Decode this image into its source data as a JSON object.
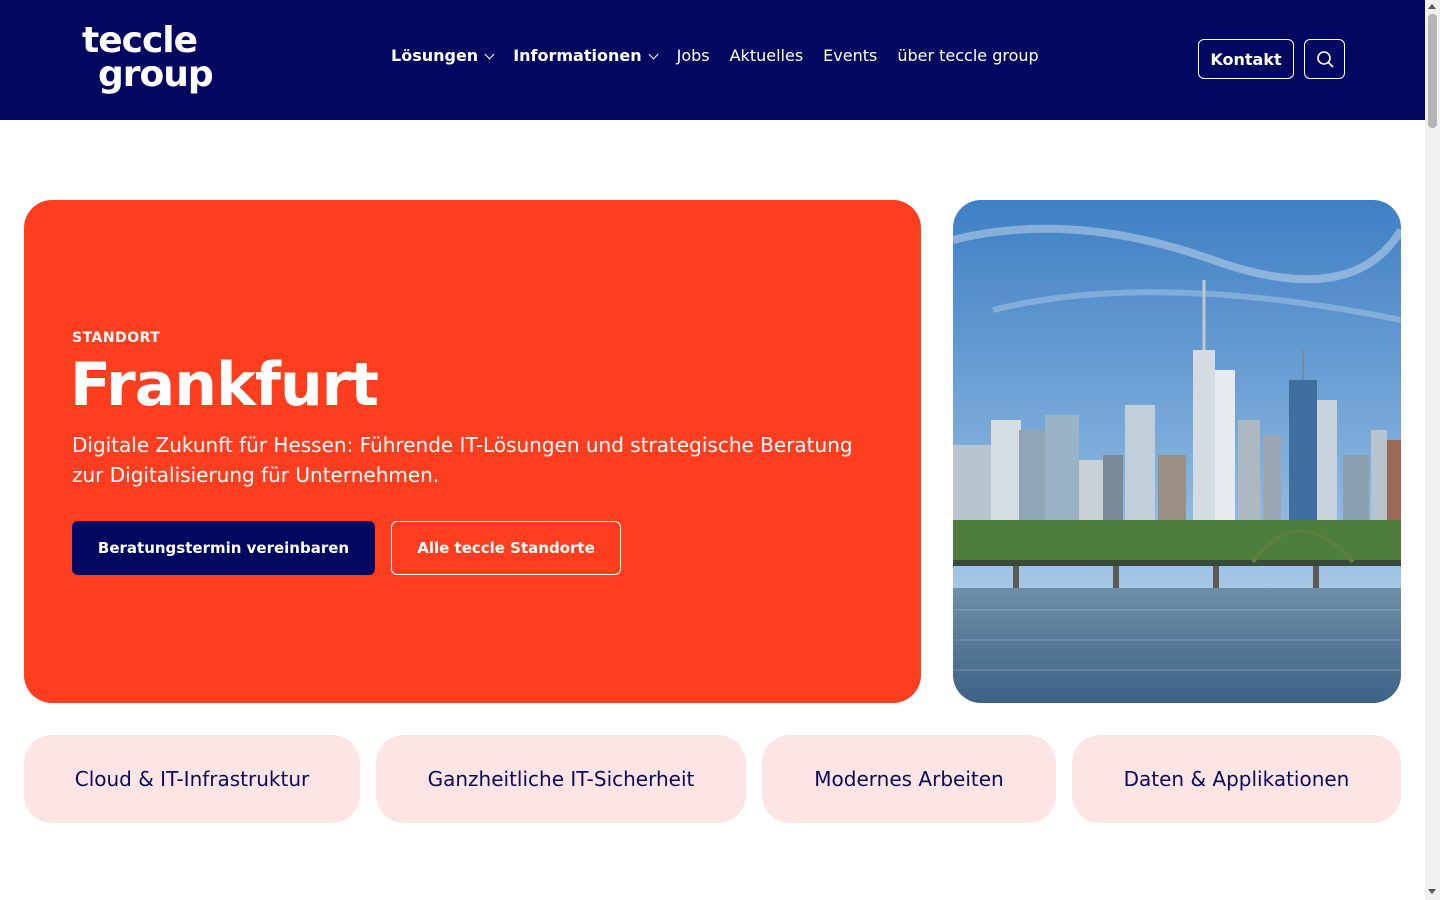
{
  "header": {
    "logo_line1": "teccle",
    "logo_line2": "group",
    "nav": [
      {
        "label": "Lösungen",
        "has_dropdown": true,
        "bold": true
      },
      {
        "label": "Informationen",
        "has_dropdown": true,
        "bold": true
      },
      {
        "label": "Jobs",
        "has_dropdown": false,
        "bold": false
      },
      {
        "label": "Aktuelles",
        "has_dropdown": false,
        "bold": false
      },
      {
        "label": "Events",
        "has_dropdown": false,
        "bold": false
      },
      {
        "label": "über teccle group",
        "has_dropdown": false,
        "bold": false
      }
    ],
    "contact_label": "Kontakt",
    "search_icon": "search-icon"
  },
  "hero": {
    "eyebrow": "STANDORT",
    "title": "Frankfurt",
    "subtitle": "Digitale Zukunft für Hessen: Führende IT-Lösungen und strategische Beratung zur Digitalisierung für Unternehmen.",
    "primary_button": "Beratungstermin vereinbaren",
    "secondary_button": "Alle teccle Standorte"
  },
  "categories": [
    {
      "label": "Cloud & IT-Infrastruktur"
    },
    {
      "label": "Ganzheitliche IT-Sicherheit"
    },
    {
      "label": "Modernes Arbeiten"
    },
    {
      "label": "Daten & Applikationen"
    }
  ],
  "colors": {
    "header_bg": "#020860",
    "hero_bg": "#ff3e1f",
    "pill_bg": "#fde5e5",
    "text_dark": "#0b0b5a"
  }
}
